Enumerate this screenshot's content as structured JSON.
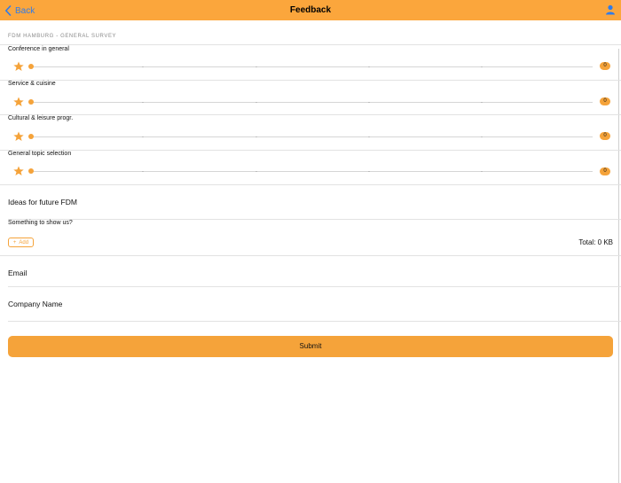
{
  "navbar": {
    "back_label": "Back",
    "title": "Feedback",
    "user_icon": "user-icon"
  },
  "survey": {
    "section_title": "FDM HAMBURG - GENERAL SURVEY",
    "ratings": [
      {
        "label": "Conference in general",
        "value": 0
      },
      {
        "label": "Service & cuisine",
        "value": 0
      },
      {
        "label": "Cultural & leisure progr.",
        "value": 0
      },
      {
        "label": "General topic selection",
        "value": 0
      }
    ],
    "ideas_placeholder": "Ideas for future FDM",
    "attachments": {
      "label": "Something to show us?",
      "add_label": "Add",
      "total": "Total: 0 KB"
    },
    "email_placeholder": "Email",
    "company_placeholder": "Company Name",
    "submit_label": "Submit"
  },
  "colors": {
    "accent": "#FBA63C",
    "link": "#2F7BEA"
  }
}
